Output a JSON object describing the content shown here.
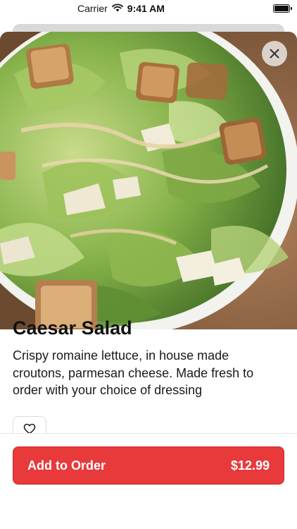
{
  "status_bar": {
    "carrier": "Carrier",
    "time": "9:41 AM",
    "wifi_icon": "wifi-icon",
    "battery_icon": "battery-icon"
  },
  "item": {
    "title": "Caesar Salad",
    "description": "Crispy romaine lettuce, in house made croutons, parmesan cheese. Made fresh to order with your choice of dressing"
  },
  "actions": {
    "close_icon": "close-icon",
    "favorite_icon": "heart-icon",
    "add_label": "Add to Order",
    "price": "$12.99"
  },
  "colors": {
    "accent": "#e8393b",
    "accent_border": "#c62828",
    "text": "#111111"
  }
}
